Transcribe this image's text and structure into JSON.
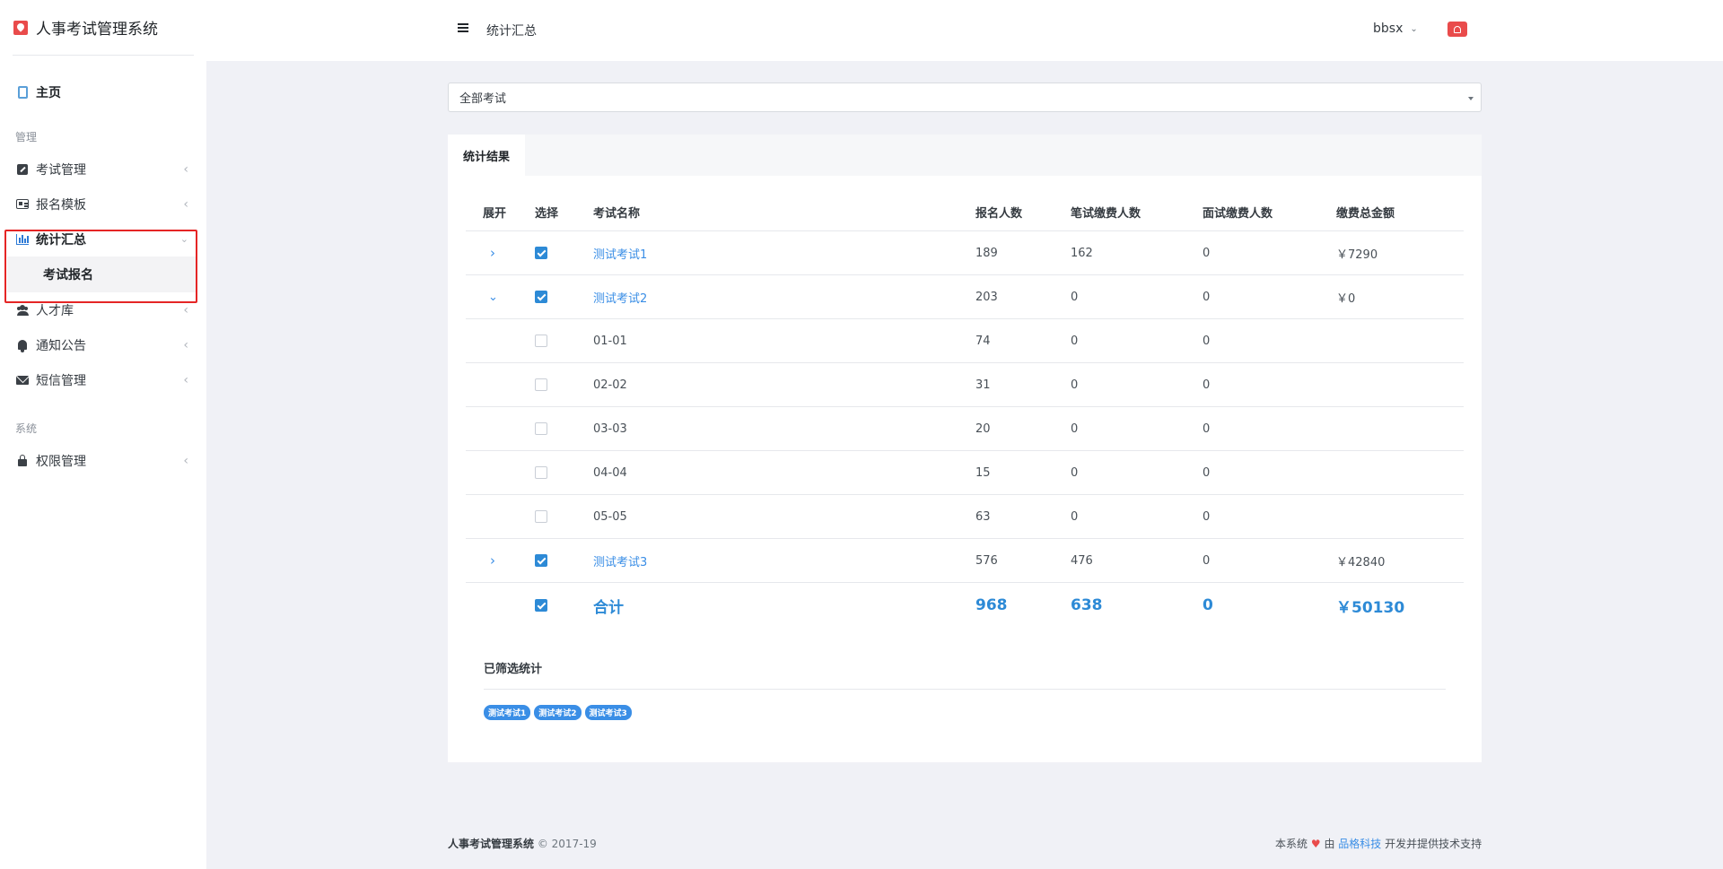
{
  "app": {
    "title": "人事考试管理系统"
  },
  "header": {
    "title": "统计汇总",
    "user": "bbsx"
  },
  "sidebar": {
    "home": "主页",
    "section_manage": "管理",
    "items": [
      {
        "label": "考试管理"
      },
      {
        "label": "报名模板"
      },
      {
        "label": "统计汇总"
      },
      {
        "label": "人才库"
      },
      {
        "label": "通知公告"
      },
      {
        "label": "短信管理"
      }
    ],
    "sub_item": "考试报名",
    "section_system": "系统",
    "system_items": [
      {
        "label": "权限管理"
      }
    ]
  },
  "filter": {
    "selected": "全部考试"
  },
  "card": {
    "tab": "统计结果"
  },
  "table": {
    "headers": [
      "展开",
      "选择",
      "考试名称",
      "报名人数",
      "笔试缴费人数",
      "面试缴费人数",
      "缴费总金额"
    ],
    "rows": [
      {
        "name": "测试考试1",
        "signup": "189",
        "written": "162",
        "interview": "0",
        "amount": "￥7290"
      },
      {
        "name": "测试考试2",
        "signup": "203",
        "written": "0",
        "interview": "0",
        "amount": "￥0"
      },
      {
        "name": "01-01",
        "signup": "74",
        "written": "0",
        "interview": "0",
        "amount": ""
      },
      {
        "name": "02-02",
        "signup": "31",
        "written": "0",
        "interview": "0",
        "amount": ""
      },
      {
        "name": "03-03",
        "signup": "20",
        "written": "0",
        "interview": "0",
        "amount": ""
      },
      {
        "name": "04-04",
        "signup": "15",
        "written": "0",
        "interview": "0",
        "amount": ""
      },
      {
        "name": "05-05",
        "signup": "63",
        "written": "0",
        "interview": "0",
        "amount": ""
      },
      {
        "name": "测试考试3",
        "signup": "576",
        "written": "476",
        "interview": "0",
        "amount": "￥42840"
      }
    ],
    "total": {
      "name": "合计",
      "signup": "968",
      "written": "638",
      "interview": "0",
      "amount": "￥50130"
    }
  },
  "filtered": {
    "title": "已筛选统计",
    "badges": [
      "测试考试1",
      "测试考试2",
      "测试考试3"
    ]
  },
  "footer": {
    "left_brand": "人事考试管理系统",
    "left_copy": "© 2017-19",
    "right_prefix": "本系统",
    "right_by": "由",
    "right_company": "品格科技",
    "right_suffix": "开发并提供技术支持"
  }
}
